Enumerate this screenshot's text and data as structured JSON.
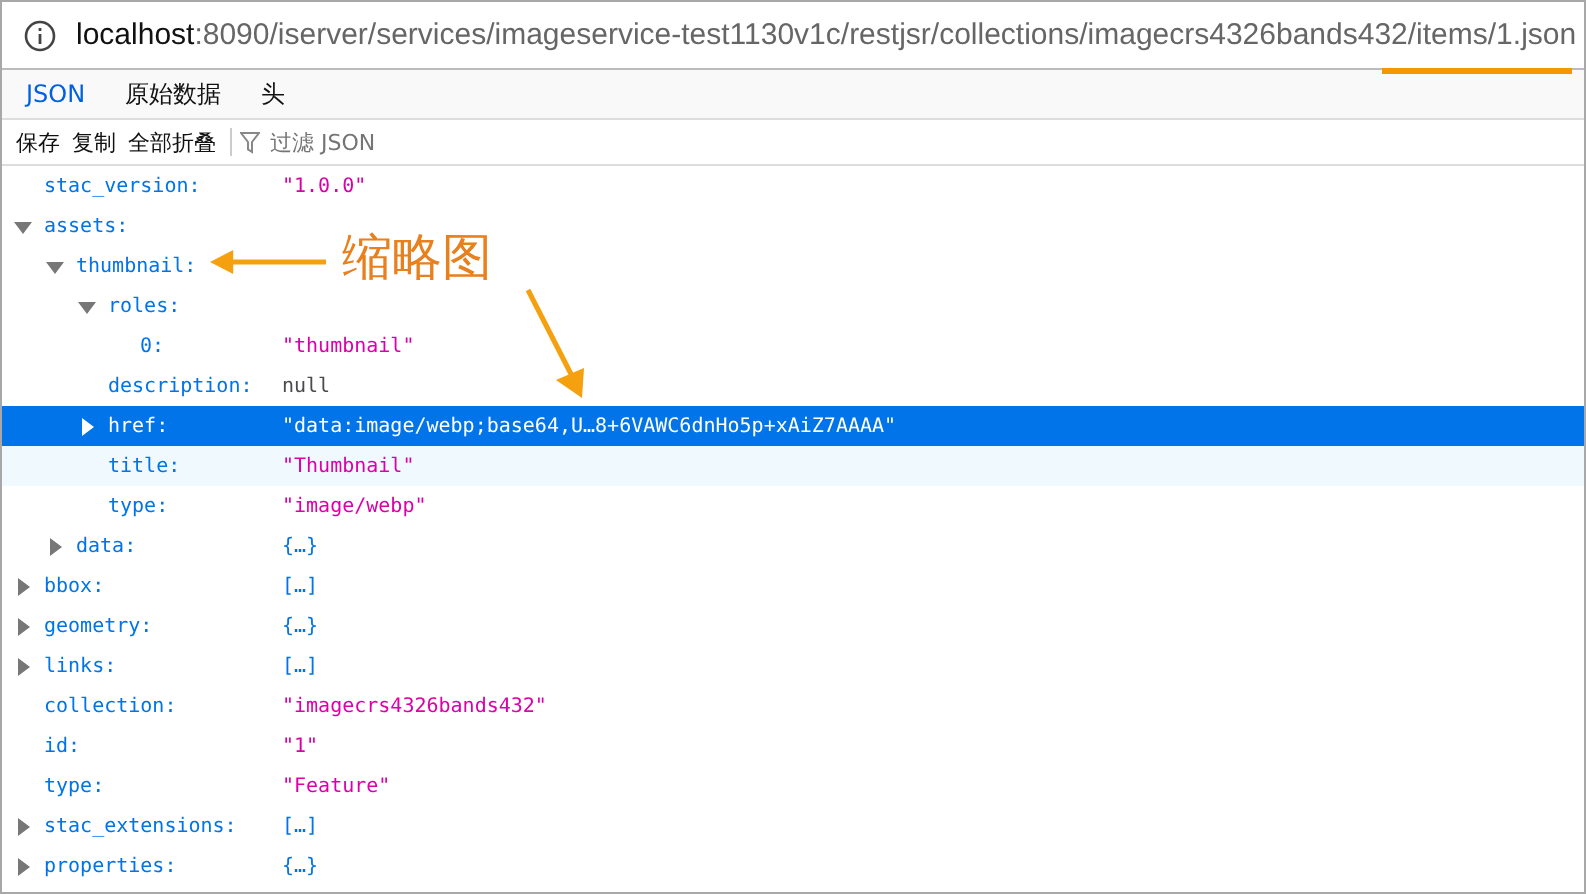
{
  "address_bar": {
    "host": "localhost",
    "path": ":8090/iserver/services/imageservice-test1130v1c/restjsr/collections/imagecrs4326bands432/items/1.json"
  },
  "tabs": [
    {
      "label": "JSON",
      "selected": true
    },
    {
      "label": "原始数据",
      "selected": false
    },
    {
      "label": "头",
      "selected": false
    }
  ],
  "toolbar": {
    "buttons": [
      "保存",
      "复制",
      "全部折叠"
    ],
    "filter_placeholder": "过滤 JSON"
  },
  "tree": [
    {
      "key": "stac_version:",
      "value": "\"1.0.0\"",
      "kind": "string",
      "selected": false,
      "hovered": false
    },
    {
      "key": "assets:",
      "expanded": true,
      "selected": false,
      "hovered": false,
      "children": [
        {
          "key": "thumbnail:",
          "expanded": true,
          "selected": false,
          "hovered": false,
          "children": [
            {
              "key": "roles:",
              "expanded": true,
              "selected": false,
              "hovered": false,
              "children": [
                {
                  "key": "0:",
                  "value": "\"thumbnail\"",
                  "kind": "string",
                  "selected": false,
                  "hovered": false
                }
              ]
            },
            {
              "key": "description:",
              "value": "null",
              "kind": "null",
              "selected": false,
              "hovered": false
            },
            {
              "key": "href:",
              "expanded": false,
              "value": "\"data:image/webp;base64,U…8+6VAWC6dnHo5p+xAiZ7AAAA\"",
              "kind": "string",
              "selected": true,
              "hovered": false
            },
            {
              "key": "title:",
              "value": "\"Thumbnail\"",
              "kind": "string",
              "selected": false,
              "hovered": true
            },
            {
              "key": "type:",
              "value": "\"image/webp\"",
              "kind": "string",
              "selected": false,
              "hovered": false
            }
          ]
        },
        {
          "key": "data:",
          "expanded": false,
          "value": "{…}",
          "kind": "collapsed",
          "selected": false,
          "hovered": false
        }
      ]
    },
    {
      "key": "bbox:",
      "expanded": false,
      "value": "[…]",
      "kind": "collapsed",
      "selected": false,
      "hovered": false
    },
    {
      "key": "geometry:",
      "expanded": false,
      "value": "{…}",
      "kind": "collapsed",
      "selected": false,
      "hovered": false
    },
    {
      "key": "links:",
      "expanded": false,
      "value": "[…]",
      "kind": "collapsed",
      "selected": false,
      "hovered": false
    },
    {
      "key": "collection:",
      "value": "\"imagecrs4326bands432\"",
      "kind": "string",
      "selected": false,
      "hovered": false
    },
    {
      "key": "id:",
      "value": "\"1\"",
      "kind": "string",
      "selected": false,
      "hovered": false
    },
    {
      "key": "type:",
      "value": "\"Feature\"",
      "kind": "string",
      "selected": false,
      "hovered": false
    },
    {
      "key": "stac_extensions:",
      "expanded": false,
      "value": "[…]",
      "kind": "collapsed",
      "selected": false,
      "hovered": false
    },
    {
      "key": "properties:",
      "expanded": false,
      "value": "{…}",
      "kind": "collapsed",
      "selected": false,
      "hovered": false
    }
  ],
  "annotation": {
    "label": "缩略图"
  }
}
